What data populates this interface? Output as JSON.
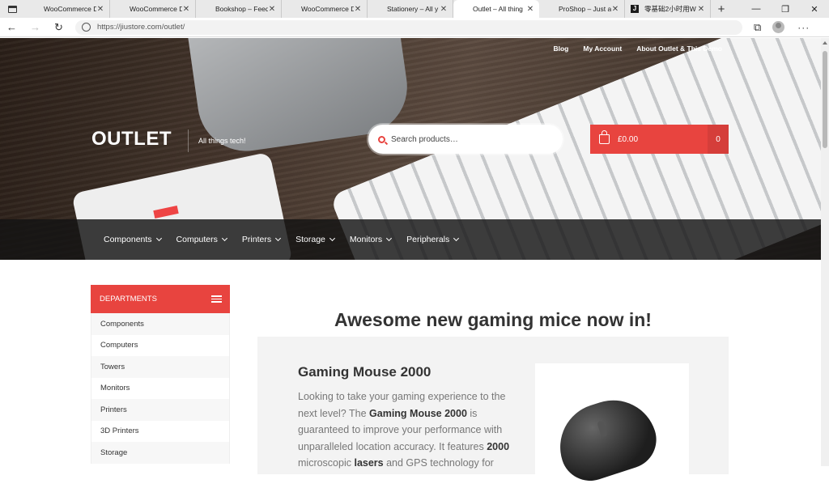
{
  "browser": {
    "tabs": [
      {
        "label": "WooCommerce D",
        "active": false
      },
      {
        "label": "WooCommerce D",
        "active": false
      },
      {
        "label": "Bookshop – Feed",
        "active": false
      },
      {
        "label": "WooCommerce D",
        "active": false
      },
      {
        "label": "Stationery – All y",
        "active": false
      },
      {
        "label": "Outlet – All thing",
        "active": true
      },
      {
        "label": "ProShop – Just ar",
        "active": false
      },
      {
        "label": "零基础2小时用W",
        "active": false
      }
    ],
    "tab_close": "✕",
    "new_tab": "+",
    "url": "https://jiustore.com/outlet/",
    "window_controls": {
      "minimize": "—",
      "maximize": "❐",
      "close": "✕"
    },
    "nav": {
      "back": "←",
      "forward": "→",
      "reload": "↻"
    },
    "extension_icon": "⧉",
    "menu": "···",
    "favicon_last": "J"
  },
  "site": {
    "top_links": [
      "Blog",
      "My Account",
      "About Outlet & This Demo"
    ],
    "logo": "OUTLET",
    "tagline": "All things tech!",
    "search_placeholder": "Search products…",
    "cart_total": "£0.00",
    "cart_count": "0",
    "main_nav": [
      "Components",
      "Computers",
      "Printers",
      "Storage",
      "Monitors",
      "Peripherals"
    ],
    "accent_color": "#e8443f"
  },
  "departments": {
    "title": "DEPARTMENTS",
    "items": [
      "Components",
      "Computers",
      "Towers",
      "Monitors",
      "Printers",
      "3D Printers",
      "Storage"
    ]
  },
  "content": {
    "headline": "Awesome new gaming mice now in!",
    "promo_title": "Gaming Mouse 2000",
    "promo_text_1": "Looking to take your gaming experience to the next level? The ",
    "promo_bold_1": "Gaming Mouse 2000",
    "promo_text_2": " is guaranteed to improve your performance with unparalleled location accuracy. It features ",
    "promo_bold_2": "2000",
    "promo_text_3": " microscopic ",
    "promo_bold_3": "lasers",
    "promo_text_4": " and GPS technology for"
  }
}
